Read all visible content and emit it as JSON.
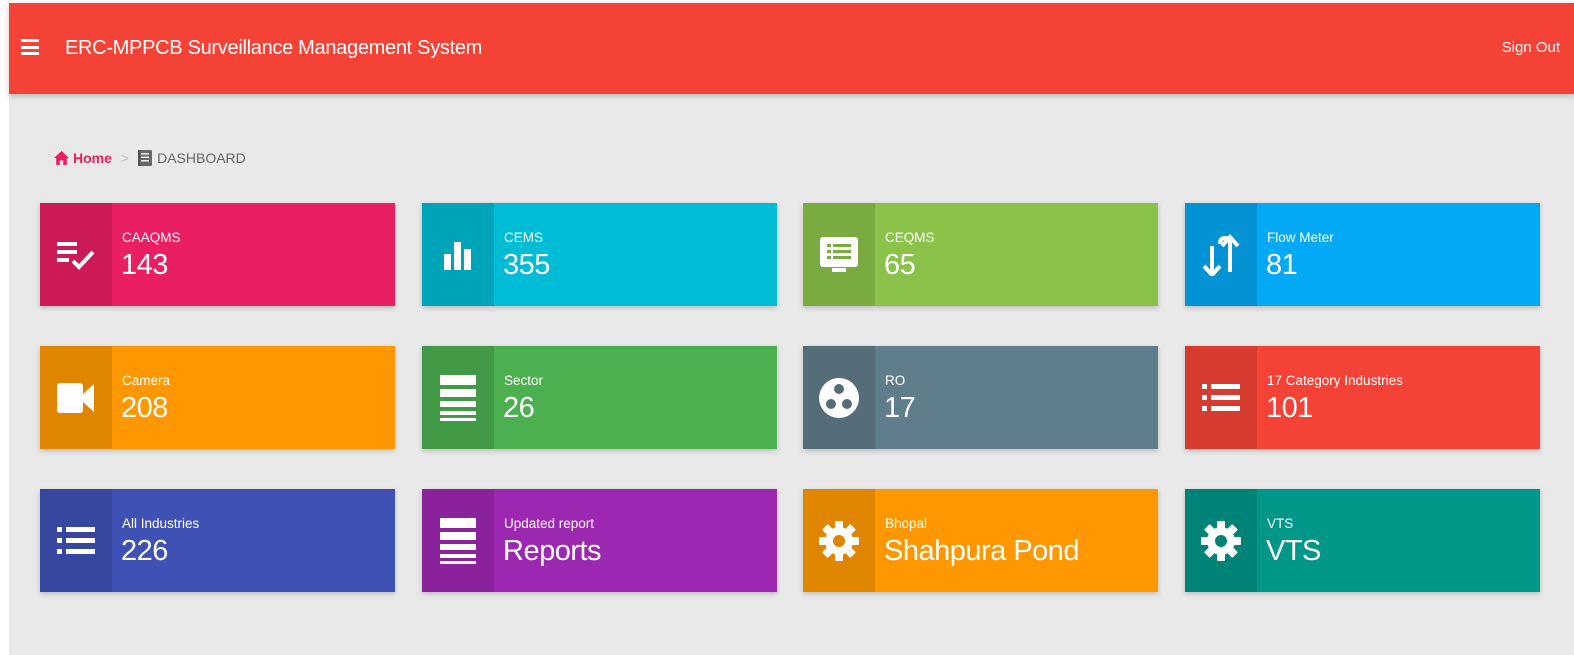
{
  "header": {
    "title": "ERC-MPPCB Surveillance Management System",
    "sign_out": "Sign Out",
    "color": "#f44336"
  },
  "breadcrumb": {
    "home": "Home",
    "separator": ">",
    "current": "DASHBOARD"
  },
  "cards": [
    {
      "label": "CAAQMS",
      "value": "143",
      "icon": "checklist-icon",
      "color": "#e91e63",
      "icon_bg": "#cb1a57"
    },
    {
      "label": "CEMS",
      "value": "355",
      "icon": "bar-chart-icon",
      "color": "#00bcd4",
      "icon_bg": "#00a4b9"
    },
    {
      "label": "CEQMS",
      "value": "65",
      "icon": "monitor-icon",
      "color": "#8bc34a",
      "icon_bg": "#7aab40"
    },
    {
      "label": "Flow Meter",
      "value": "81",
      "icon": "swap-vertical-icon",
      "color": "#03a9f4",
      "icon_bg": "#0393d5"
    },
    {
      "label": "Camera",
      "value": "208",
      "icon": "video-camera-icon",
      "color": "#ff9800",
      "icon_bg": "#e08500"
    },
    {
      "label": "Sector",
      "value": "26",
      "icon": "lines-icon",
      "color": "#4caf50",
      "icon_bg": "#429a46"
    },
    {
      "label": "RO",
      "value": "17",
      "icon": "ro-circle-icon",
      "color": "#607d8b",
      "icon_bg": "#546d79"
    },
    {
      "label": "17 Category Industries",
      "value": "101",
      "icon": "list-icon",
      "color": "#f44336",
      "icon_bg": "#d63b2f"
    },
    {
      "label": "All Industries",
      "value": "226",
      "icon": "list-icon",
      "color": "#3f51b5",
      "icon_bg": "#37479f"
    },
    {
      "label": "Updated report",
      "value": "Reports",
      "icon": "lines-icon",
      "color": "#9c27b0",
      "icon_bg": "#89229b"
    },
    {
      "label": "Bhopal",
      "value": "Shahpura Pond",
      "icon": "gear-icon",
      "color": "#ff9800",
      "icon_bg": "#e08500"
    },
    {
      "label": "VTS",
      "value": "VTS",
      "icon": "gear-icon",
      "color": "#009688",
      "icon_bg": "#008377"
    }
  ]
}
